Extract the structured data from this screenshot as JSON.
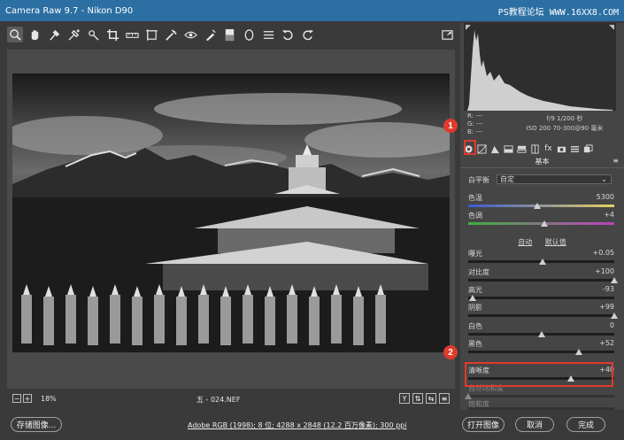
{
  "window": {
    "title": "Camera Raw 9.7  -  Nikon D90",
    "watermark": "PS教程论坛 WWW.16XX8.COM"
  },
  "toolbar": {
    "tools": [
      "zoom-icon",
      "hand-icon",
      "white-balance-icon",
      "color-sampler-icon",
      "targeted-adjust-icon",
      "crop-icon",
      "straighten-icon",
      "transform-icon",
      "spot-removal-icon",
      "red-eye-icon",
      "adjustment-brush-icon",
      "graduated-filter-icon",
      "radial-filter-icon",
      "preferences-icon",
      "rotate-ccw-icon",
      "rotate-cw-icon"
    ],
    "selected": "zoom-icon",
    "fullscreen_icon": "fullscreen-icon"
  },
  "status": {
    "zoom": "18%",
    "filename": "五 - 024.NEF",
    "view_buttons": [
      "Y",
      "⇅",
      "⇆",
      "≡"
    ]
  },
  "bottom": {
    "save_label": "存储图像...",
    "workflow_link": "Adobe RGB (1998); 8 位; 4288 x 2848 (12.2 百万像素); 300 ppi",
    "open_label": "打开图像",
    "cancel_label": "取消",
    "done_label": "完成"
  },
  "histogram_info": {
    "r": "R: ---",
    "g": "G: ---",
    "b": "B: ---",
    "aperture_shutter": "f/9   1/200 秒",
    "iso_lens": "ISO 200   70-300@90 毫米"
  },
  "panel": {
    "title": "基本",
    "wb_label": "白平衡",
    "wb_value": "自定",
    "auto_label": "自动",
    "default_label": "默认值"
  },
  "sliders": {
    "temperature": {
      "label": "色温",
      "value": "5300",
      "pos": 0.47
    },
    "tint": {
      "label": "色调",
      "value": "+4",
      "pos": 0.52
    },
    "exposure": {
      "label": "曝光",
      "value": "+0.05",
      "pos": 0.51
    },
    "contrast": {
      "label": "对比度",
      "value": "+100",
      "pos": 1.0
    },
    "highlights": {
      "label": "高光",
      "value": "-93",
      "pos": 0.03
    },
    "shadows": {
      "label": "阴影",
      "value": "+99",
      "pos": 1.0
    },
    "whites": {
      "label": "白色",
      "value": "0",
      "pos": 0.5
    },
    "blacks": {
      "label": "黑色",
      "value": "+52",
      "pos": 0.76
    },
    "clarity": {
      "label": "清晰度",
      "value": "+40",
      "pos": 0.7
    },
    "vibrance": {
      "label": "自然饱和度",
      "value": "",
      "pos": 0.0
    },
    "saturation": {
      "label": "饱和度",
      "value": "",
      "pos": 0.0
    }
  },
  "callouts": {
    "one": "1",
    "two": "2"
  },
  "colors": {
    "titlebar": "#2b6fa3",
    "callout": "#e03a2e"
  }
}
